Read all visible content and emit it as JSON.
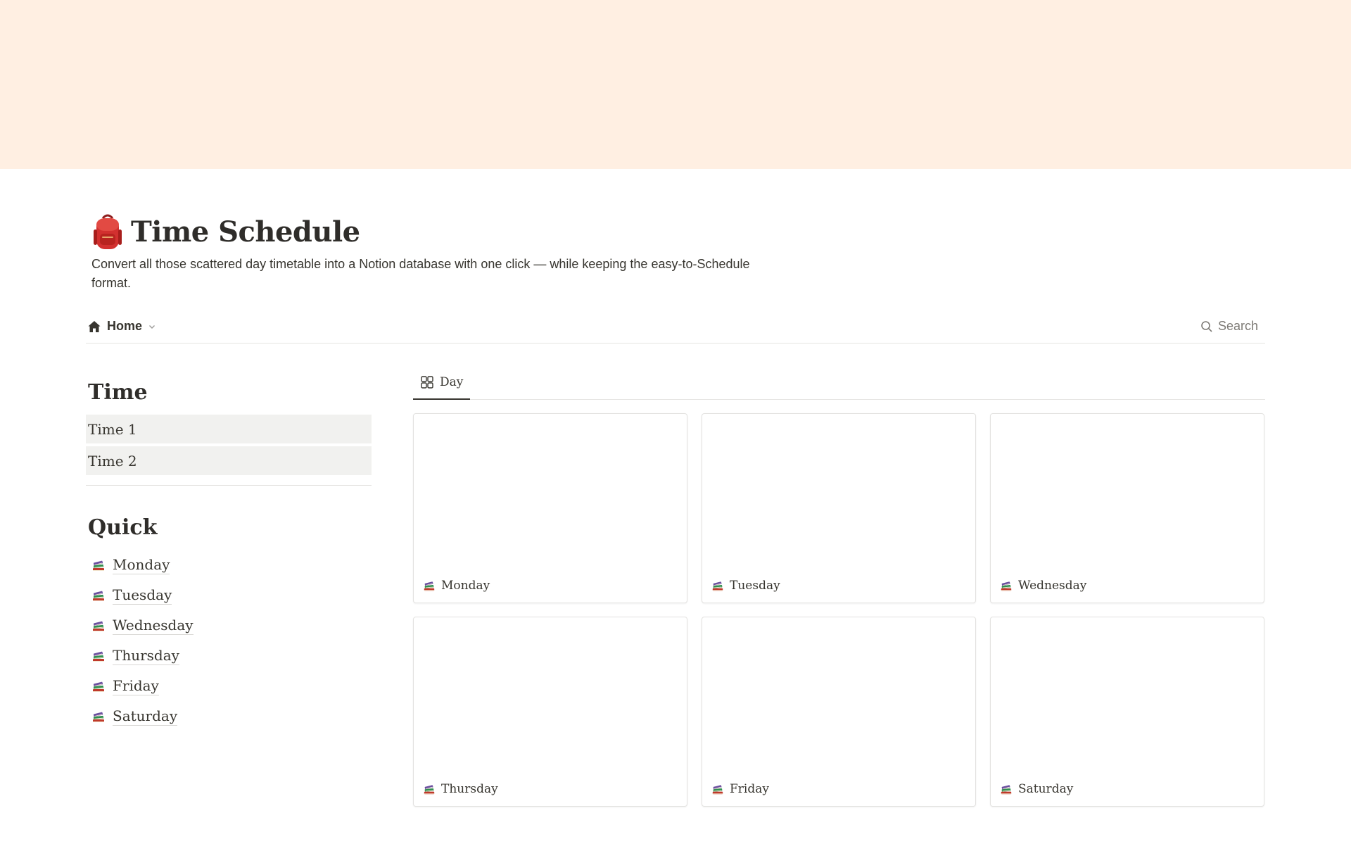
{
  "colors": {
    "cover": "#ffefe2",
    "text": "#37352f",
    "muted": "#7d7a75",
    "item_bg": "#f1f1ef",
    "border": "#e3e2e0"
  },
  "page": {
    "icon": "backpack-icon",
    "title": "Time Schedule",
    "description": "Convert all those scattered day timetable into a Notion database with one click — while keeping the easy-to-Schedule format."
  },
  "nav": {
    "home_icon": "house-icon",
    "home_label": "Home",
    "search_icon": "search-icon",
    "search_label": "Search"
  },
  "sidebar": {
    "time_heading": "Time",
    "time_items": [
      {
        "label": "Time 1"
      },
      {
        "label": "Time 2"
      }
    ],
    "quick_heading": "Quick",
    "quick_items": [
      {
        "label": "Monday",
        "icon": "books-icon"
      },
      {
        "label": "Tuesday",
        "icon": "books-icon"
      },
      {
        "label": "Wednesday",
        "icon": "books-icon"
      },
      {
        "label": "Thursday",
        "icon": "books-icon"
      },
      {
        "label": "Friday",
        "icon": "books-icon"
      },
      {
        "label": "Saturday",
        "icon": "books-icon"
      }
    ]
  },
  "main": {
    "tabs": [
      {
        "label": "Day",
        "icon": "gallery-icon",
        "active": true
      }
    ],
    "cards": [
      {
        "label": "Monday",
        "icon": "books-icon"
      },
      {
        "label": "Tuesday",
        "icon": "books-icon"
      },
      {
        "label": "Wednesday",
        "icon": "books-icon"
      },
      {
        "label": "Thursday",
        "icon": "books-icon"
      },
      {
        "label": "Friday",
        "icon": "books-icon"
      },
      {
        "label": "Saturday",
        "icon": "books-icon"
      }
    ]
  }
}
